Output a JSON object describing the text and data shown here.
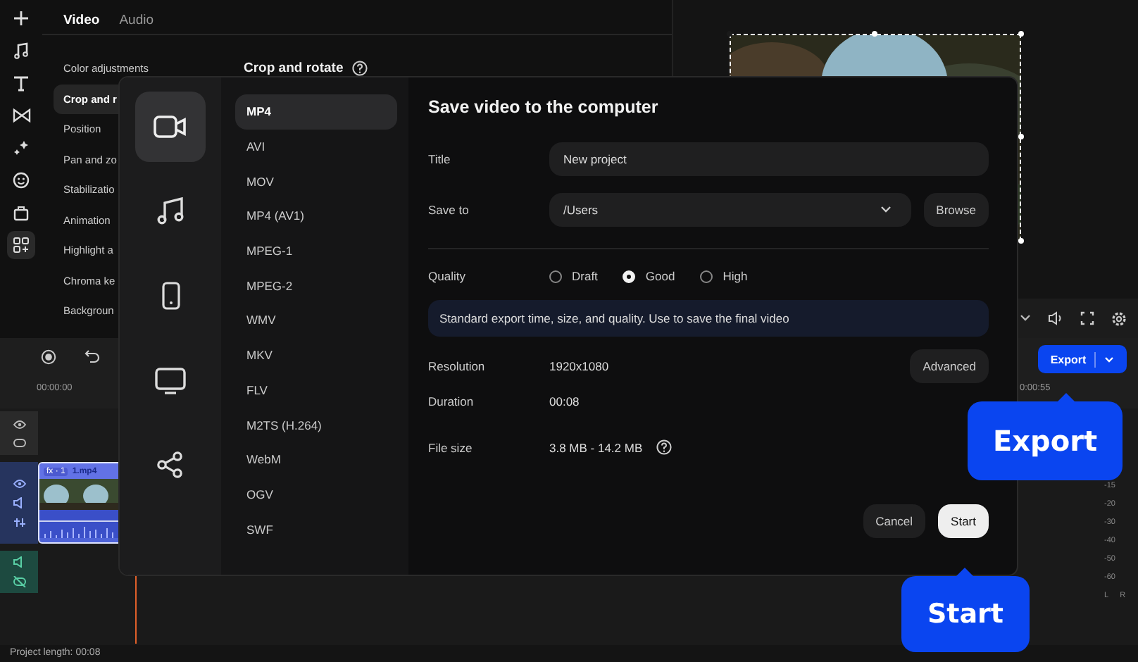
{
  "left_toolbar": [
    {
      "kind": "add",
      "selected": false
    },
    {
      "kind": "music",
      "selected": false
    },
    {
      "kind": "text",
      "selected": false
    },
    {
      "kind": "transitions",
      "selected": false
    },
    {
      "kind": "effects",
      "selected": false
    },
    {
      "kind": "stickers",
      "selected": false
    },
    {
      "kind": "bag",
      "selected": false
    },
    {
      "kind": "apps",
      "selected": true
    }
  ],
  "properties": {
    "tabs": [
      {
        "label": "Video",
        "selected": true
      },
      {
        "label": "Audio",
        "selected": false
      }
    ],
    "items": [
      {
        "label": "Color adjustments",
        "selected": false
      },
      {
        "label": "Crop and r",
        "selected": true
      },
      {
        "label": "Position",
        "selected": false
      },
      {
        "label": "Pan and zo",
        "selected": false
      },
      {
        "label": "Stabilizatio",
        "selected": false
      },
      {
        "label": "Animation",
        "selected": false
      },
      {
        "label": "Highlight a",
        "selected": false
      },
      {
        "label": "Chroma ke",
        "selected": false
      },
      {
        "label": "Backgroun",
        "selected": false
      }
    ],
    "section_title": "Crop and rotate"
  },
  "timeline": {
    "timecode_start": "00:00:00",
    "timecode_end": "0:00:55",
    "tracks": [
      {
        "kind": "overlay"
      },
      {
        "kind": "video"
      },
      {
        "kind": "audio"
      }
    ],
    "clip": {
      "badge": "fx · 1",
      "name": "1.mp4"
    }
  },
  "export_button": {
    "label": "Export"
  },
  "meter": {
    "labels": [
      "-15",
      "-20",
      "-30",
      "-40",
      "-50",
      "-60"
    ],
    "channels": [
      "L",
      "R"
    ]
  },
  "status_bar": "Project length: 00:08",
  "dialog": {
    "categories": [
      {
        "kind": "video",
        "selected": true
      },
      {
        "kind": "audio",
        "selected": false
      },
      {
        "kind": "phone",
        "selected": false
      },
      {
        "kind": "tv",
        "selected": false
      },
      {
        "kind": "share",
        "selected": false
      }
    ],
    "formats": [
      {
        "label": "MP4",
        "selected": true
      },
      {
        "label": "AVI",
        "selected": false
      },
      {
        "label": "MOV",
        "selected": false
      },
      {
        "label": "MP4 (AV1)",
        "selected": false
      },
      {
        "label": "MPEG-1",
        "selected": false
      },
      {
        "label": "MPEG-2",
        "selected": false
      },
      {
        "label": "WMV",
        "selected": false
      },
      {
        "label": "MKV",
        "selected": false
      },
      {
        "label": "FLV",
        "selected": false
      },
      {
        "label": "M2TS (H.264)",
        "selected": false
      },
      {
        "label": "WebM",
        "selected": false
      },
      {
        "label": "OGV",
        "selected": false
      },
      {
        "label": "SWF",
        "selected": false
      }
    ],
    "title": "Save video to the computer",
    "title_label": "Title",
    "title_value": "New project",
    "save_to_label": "Save to",
    "save_to_value": "/Users",
    "browse": "Browse",
    "quality_label": "Quality",
    "quality_options": [
      {
        "label": "Draft",
        "selected": false
      },
      {
        "label": "Good",
        "selected": true
      },
      {
        "label": "High",
        "selected": false
      }
    ],
    "description": "Standard export time, size, and quality. Use to save the final video",
    "info": [
      {
        "label": "Resolution",
        "value": "1920x1080"
      },
      {
        "label": "Duration",
        "value": "00:08"
      },
      {
        "label": "File size",
        "value": "3.8 MB - 14.2 MB"
      }
    ],
    "advanced": "Advanced",
    "cancel": "Cancel",
    "start": "Start"
  },
  "callouts": [
    {
      "kind": "export",
      "label": "Export"
    },
    {
      "kind": "start",
      "label": "Start"
    }
  ]
}
